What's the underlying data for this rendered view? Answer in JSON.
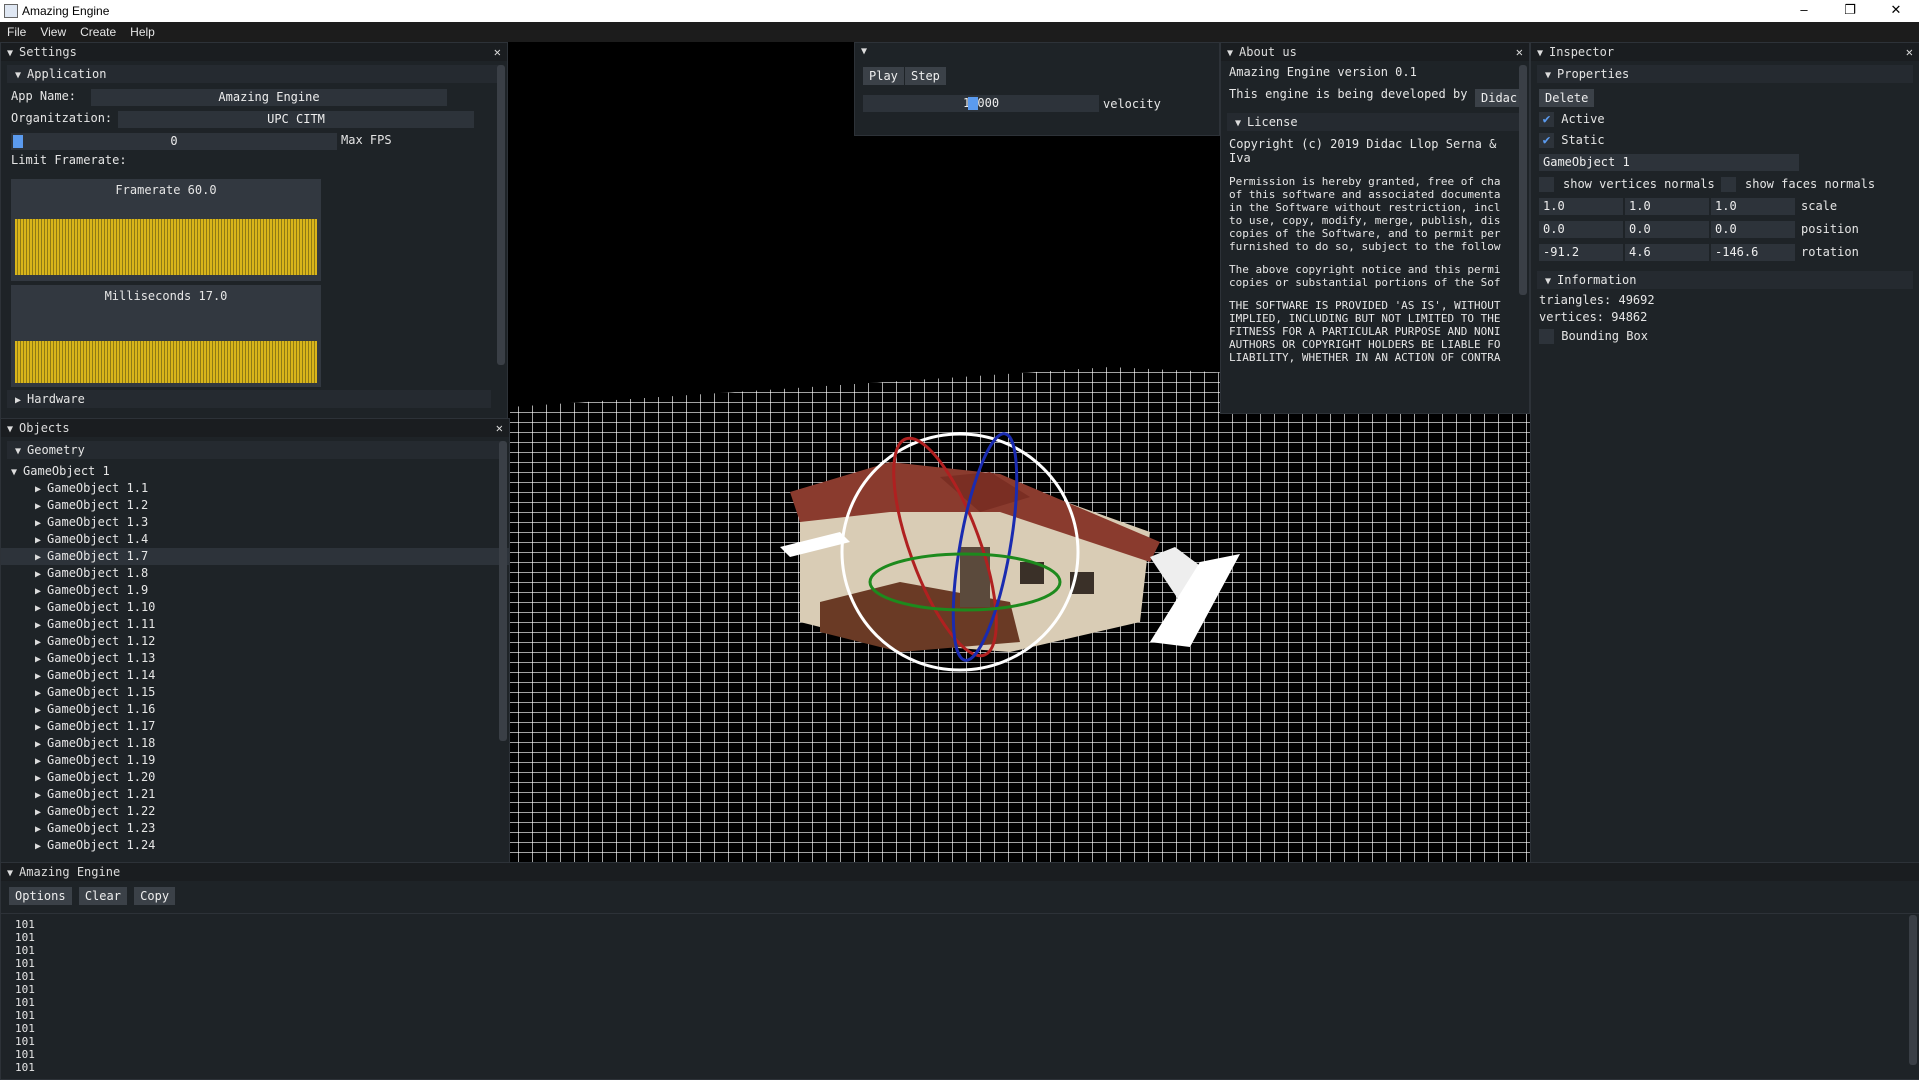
{
  "window": {
    "title": "Amazing Engine",
    "minimize": "–",
    "maximize": "❐",
    "close": "✕"
  },
  "menubar": [
    "File",
    "View",
    "Create",
    "Help"
  ],
  "settings": {
    "title": "Settings",
    "application_label": "Application",
    "app_name_label": "App Name:",
    "app_name": "Amazing Engine",
    "org_label": "Organitzation:",
    "org": "UPC CITM",
    "max_fps_value": "0",
    "max_fps_label": "Max FPS",
    "limit_label": "Limit Framerate:",
    "framerate_title": "Framerate 60.0",
    "ms_title": "Milliseconds 17.0",
    "hardware_label": "Hardware"
  },
  "objects": {
    "title": "Objects",
    "geometry_label": "Geometry",
    "root": "GameObject 1",
    "children": [
      "GameObject 1.1",
      "GameObject 1.2",
      "GameObject 1.3",
      "GameObject 1.4",
      "GameObject 1.7",
      "GameObject 1.8",
      "GameObject 1.9",
      "GameObject 1.10",
      "GameObject 1.11",
      "GameObject 1.12",
      "GameObject 1.13",
      "GameObject 1.14",
      "GameObject 1.15",
      "GameObject 1.16",
      "GameObject 1.17",
      "GameObject 1.18",
      "GameObject 1.19",
      "GameObject 1.20",
      "GameObject 1.21",
      "GameObject 1.22",
      "GameObject 1.23",
      "GameObject 1.24"
    ],
    "selected_index": 4
  },
  "playbar": {
    "play": "Play",
    "step": "Step",
    "velocity_value": "1.000",
    "velocity_label": "velocity"
  },
  "about": {
    "title": "About us",
    "version": "Amazing Engine version 0.1",
    "developed_by": "This engine is being developed by",
    "dev_button": "Didac",
    "license_label": "License",
    "copyright": "Copyright (c) 2019 Didac Llop Serna & Iva",
    "p1": "Permission is hereby granted, free of cha\nof this software and associated documenta\nin the Software without restriction, incl\nto use, copy, modify, merge, publish, dis\ncopies of the Software, and to permit per\nfurnished to do so, subject to the follow",
    "p2": "The above copyright notice and this permi\ncopies or substantial portions of the Sof",
    "p3": "THE SOFTWARE IS PROVIDED 'AS IS', WITHOUT\nIMPLIED, INCLUDING BUT NOT LIMITED TO THE\nFITNESS FOR A PARTICULAR PURPOSE AND NONI\nAUTHORS OR COPYRIGHT HOLDERS BE LIABLE FO\nLIABILITY, WHETHER IN AN ACTION OF CONTRA"
  },
  "inspector": {
    "title": "Inspector",
    "properties_label": "Properties",
    "delete": "Delete",
    "active_label": "Active",
    "static_label": "Static",
    "name_value": "GameObject 1",
    "show_vertices": "show vertices normals",
    "show_faces": "show faces normals",
    "scale": [
      "1.0",
      "1.0",
      "1.0"
    ],
    "scale_label": "scale",
    "position": [
      "0.0",
      "0.0",
      "0.0"
    ],
    "position_label": "position",
    "rotation": [
      "-91.2",
      "4.6",
      "-146.6"
    ],
    "rotation_label": "rotation",
    "information_label": "Information",
    "triangles": "triangles: 49692",
    "vertices": "vertices: 94862",
    "bbox_label": "Bounding Box"
  },
  "console": {
    "title": "Amazing Engine",
    "options": "Options",
    "clear": "Clear",
    "copy": "Copy",
    "lines": [
      "101",
      "101",
      "101",
      "101",
      "101",
      "101",
      "101",
      "101",
      "101",
      "101",
      "101",
      "101"
    ]
  },
  "colors": {
    "accent": "#5b9bef",
    "plot": "#d9b51a",
    "panel": "#1e2327"
  }
}
